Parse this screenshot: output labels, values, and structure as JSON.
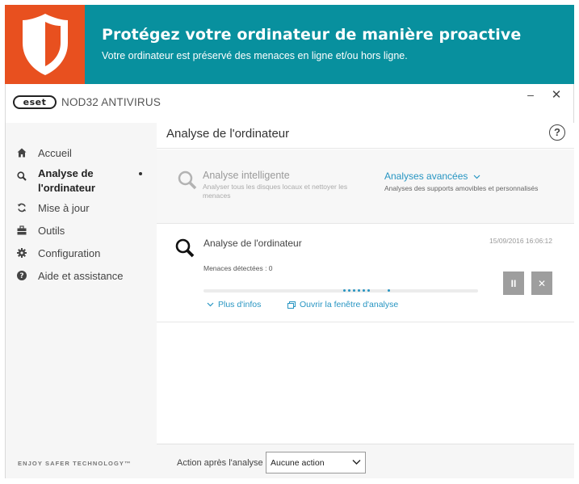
{
  "banner": {
    "title": "Protégez votre ordinateur de manière proactive",
    "subtitle": "Votre ordinateur est préservé des menaces en ligne et/ou hors ligne.",
    "icon": "shield-icon",
    "colors": {
      "icon_bg": "#e8501f",
      "bg": "#08909e"
    }
  },
  "window": {
    "logo_text": "eset",
    "product_name": "NOD32 ANTIVIRUS",
    "minimize_symbol": "–",
    "close_symbol": "✕"
  },
  "sidebar": {
    "items": [
      {
        "label": "Accueil",
        "icon": "home-icon",
        "active": false
      },
      {
        "label": "Analyse de l'ordinateur",
        "icon": "search-icon",
        "active": true
      },
      {
        "label": "Mise à jour",
        "icon": "refresh-icon",
        "active": false
      },
      {
        "label": "Outils",
        "icon": "toolbox-icon",
        "active": false
      },
      {
        "label": "Configuration",
        "icon": "gear-icon",
        "active": false
      },
      {
        "label": "Aide et assistance",
        "icon": "help-circle-icon",
        "active": false
      }
    ],
    "tagline": "ENJOY SAFER TECHNOLOGY™"
  },
  "main": {
    "title": "Analyse de l'ordinateur",
    "help_symbol": "?",
    "smart_scan": {
      "title": "Analyse intelligente",
      "description": "Analyser tous les disques locaux et nettoyer les menaces"
    },
    "advanced_scan": {
      "title": "Analyses avancées",
      "description": "Analyses des supports amovibles et personnalisés"
    },
    "current_scan": {
      "name": "Analyse de l'ordinateur",
      "date": "15/09/2016 16:06:12",
      "threats_label": "Menaces détectées : 0",
      "more_info": "Plus d'infos",
      "open_window": "Ouvrir la fenêtre d'analyse",
      "pause_symbol": "II",
      "stop_symbol": "✕"
    },
    "footer": {
      "action_label": "Action après l'analyse",
      "action_value": "Aucune action"
    }
  },
  "colors": {
    "accent": "#2795c2"
  }
}
